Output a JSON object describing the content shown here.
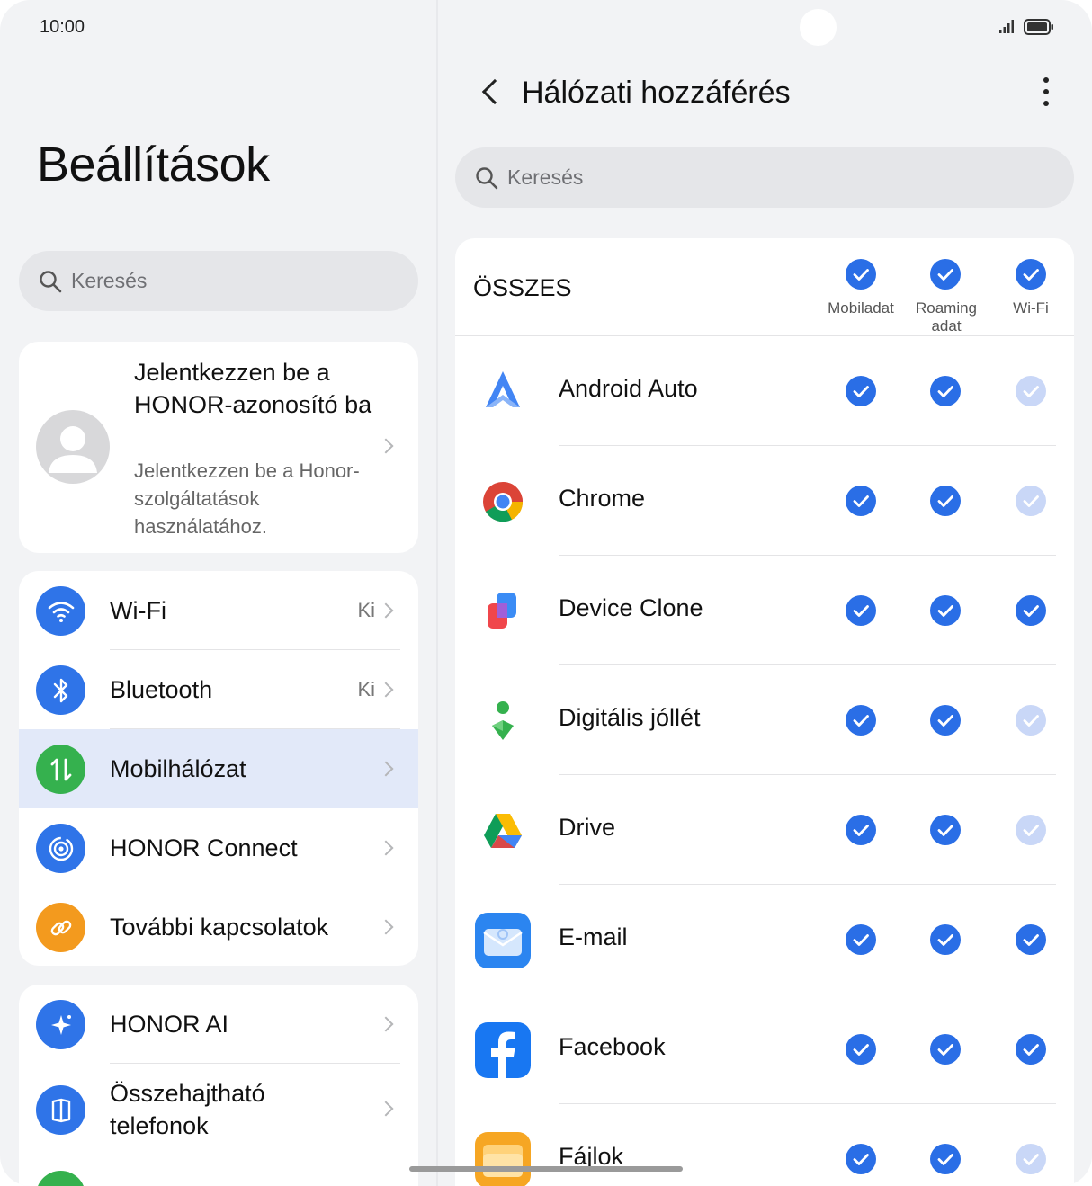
{
  "status": {
    "time": "10:00"
  },
  "left": {
    "title": "Beállítások",
    "search_placeholder": "Keresés",
    "account": {
      "title": "Jelentkezzen be a HONOR-azonosító ba",
      "subtitle": "Jelentkezzen be a Honor-szolgáltatások használatához."
    },
    "group1": [
      {
        "label": "Wi-Fi",
        "value": "Ki",
        "icon": "wifi-icon",
        "color": "#2f74e8"
      },
      {
        "label": "Bluetooth",
        "value": "Ki",
        "icon": "bluetooth-icon",
        "color": "#2f74e8"
      },
      {
        "label": "Mobilhálózat",
        "value": "",
        "icon": "mobile-data-icon",
        "color": "#35b14e"
      },
      {
        "label": "HONOR Connect",
        "value": "",
        "icon": "honor-connect-icon",
        "color": "#2f74e8"
      },
      {
        "label": "További kapcsolatok",
        "value": "",
        "icon": "link-icon",
        "color": "#f39a1e"
      }
    ],
    "group2": [
      {
        "label": "HONOR AI",
        "icon": "ai-sparkle-icon",
        "color": "#2f74e8"
      },
      {
        "label": "Összehajtható telefonok",
        "icon": "foldable-phone-icon",
        "color": "#2f74e8"
      }
    ]
  },
  "right": {
    "title": "Hálózati hozzáférés",
    "search_placeholder": "Keresés",
    "all_label": "ÖSSZES",
    "columns": [
      "Mobiladat",
      "Roaming adat",
      "Wi-Fi"
    ],
    "apps": [
      {
        "name": "Android Auto",
        "checks": [
          true,
          true,
          false
        ]
      },
      {
        "name": "Chrome",
        "checks": [
          true,
          true,
          false
        ]
      },
      {
        "name": "Device Clone",
        "checks": [
          true,
          true,
          true
        ]
      },
      {
        "name": "Digitális jóllét",
        "checks": [
          true,
          true,
          false
        ]
      },
      {
        "name": "Drive",
        "checks": [
          true,
          true,
          false
        ]
      },
      {
        "name": "E-mail",
        "checks": [
          true,
          true,
          true
        ]
      },
      {
        "name": "Facebook",
        "checks": [
          true,
          true,
          true
        ]
      },
      {
        "name": "Fájlok",
        "checks": [
          true,
          true,
          false
        ]
      }
    ]
  },
  "colors": {
    "accent": "#2a6ee6",
    "accent_dim": "#c9d7f7",
    "selected_row": "#e2e9f9"
  }
}
